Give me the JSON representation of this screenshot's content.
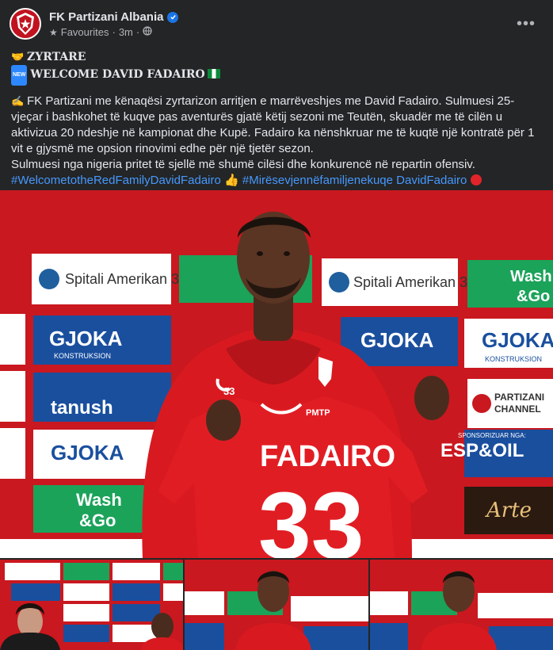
{
  "page": {
    "name": "FK Partizani Albania",
    "audience": "Favourites",
    "time": "3m",
    "separator": "·"
  },
  "post": {
    "official_label": "ZYRTARE",
    "welcome_line": "WELCOME DAVID FADAIRO",
    "paragraph": "FK Partizani me kënaqësi zyrtarizon arritjen e marrëveshjes me David Fadairo. Sulmuesi 25-vjeçar i bashkohet të kuqve pas aventurës gjatë këtij sezoni me Teutën, skuadër me të cilën u aktivizua 20 ndeshje në kampionat dhe Kupë. Fadairo ka nënshkruar me të kuqtë një kontratë për 1 vit e gjysmë me opsion rinovimi edhe për një tjetër sezon.",
    "paragraph2": "Sulmuesi nga nigeria pritet të sjellë më shumë cilësi dhe konkurencë në repartin ofensiv.",
    "hashtag1": "#WelcometotheRedFamilyDavidFadairo",
    "hashtag2": "#Mirësevjennëfamiljenekuqe DavidFadairo"
  },
  "photo": {
    "sponsors": {
      "spitali": "Spitali Amerikan 3",
      "gjoka": "GJOKA",
      "gjoka_sub": "KONSTRUKSION",
      "tanush": "tanush",
      "wash1": "Wash",
      "wash2": "&Go",
      "partizani_channel1": "PARTIZANI",
      "partizani_channel2": "CHANNEL",
      "sponsor_label": "SPONSORIZUAR NGA:",
      "espoil": "ESP&OIL",
      "arte": "Arte"
    },
    "shirt_name": "FADAIRO",
    "shirt_number": "33",
    "shirt_sponsor": "PMTP",
    "hoodie_number": "33"
  },
  "colors": {
    "background": "#242526",
    "text": "#e4e6eb",
    "secondary_text": "#b0b3b8",
    "hashtag": "#4599ff",
    "brand_red": "#c9181f"
  },
  "icons": {
    "verified": "verified-badge-icon",
    "star": "star-icon",
    "globe": "globe-icon",
    "more": "more-options-icon"
  }
}
